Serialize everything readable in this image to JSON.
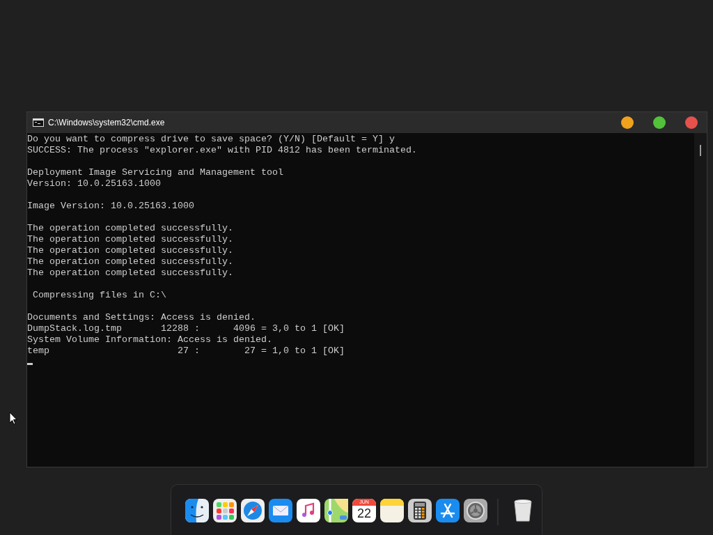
{
  "window": {
    "title": "C:\\Windows\\system32\\cmd.exe"
  },
  "console": {
    "blocks": [
      [
        "Do you want to compress drive to save space? (Y/N) [Default = Y] y",
        "SUCCESS: The process \"explorer.exe\" with PID 4812 has been terminated."
      ],
      [
        "Deployment Image Servicing and Management tool",
        "Version: 10.0.25163.1000"
      ],
      [
        "Image Version: 10.0.25163.1000"
      ],
      [
        "The operation completed successfully.",
        "The operation completed successfully.",
        "The operation completed successfully.",
        "The operation completed successfully.",
        "The operation completed successfully."
      ],
      [
        " Compressing files in C:\\"
      ],
      [
        "Documents and Settings: Access is denied.",
        "DumpStack.log.tmp       12288 :      4096 = 3,0 to 1 [OK]",
        "System Volume Information: Access is denied.",
        "temp                       27 :        27 = 1,0 to 1 [OK]"
      ]
    ]
  },
  "dock": {
    "apps": [
      {
        "kind": "finder"
      },
      {
        "kind": "launchpad"
      },
      {
        "kind": "safari"
      },
      {
        "kind": "mail"
      },
      {
        "kind": "music"
      },
      {
        "kind": "maps"
      },
      {
        "kind": "calendar",
        "month": "JUN",
        "day": "22"
      },
      {
        "kind": "notes"
      },
      {
        "kind": "calculator"
      },
      {
        "kind": "appstore"
      },
      {
        "kind": "settings"
      },
      {
        "kind": "separator"
      },
      {
        "kind": "trash"
      }
    ]
  }
}
